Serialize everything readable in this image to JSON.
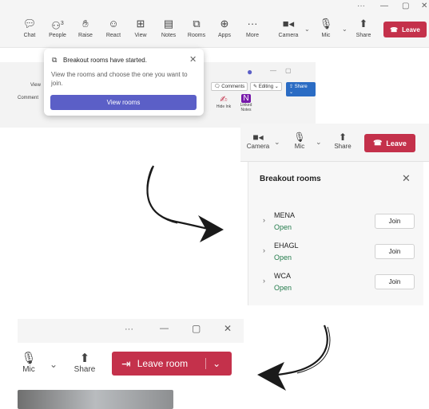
{
  "colors": {
    "leave": "#c4314b",
    "accent": "#5b5fc7",
    "open_status": "#237b4b"
  },
  "toolbar": {
    "items": [
      {
        "label": "Chat",
        "icon": "chat-icon"
      },
      {
        "label": "People",
        "icon": "people-icon",
        "badge": "3"
      },
      {
        "label": "Raise",
        "icon": "hand-icon"
      },
      {
        "label": "React",
        "icon": "smile-icon"
      },
      {
        "label": "View",
        "icon": "view-icon"
      },
      {
        "label": "Notes",
        "icon": "notes-icon"
      },
      {
        "label": "Rooms",
        "icon": "rooms-icon"
      },
      {
        "label": "Apps",
        "icon": "apps-icon"
      },
      {
        "label": "More",
        "icon": "more-icon"
      }
    ],
    "camera": "Camera",
    "mic": "Mic",
    "share": "Share",
    "leave": "Leave"
  },
  "doc_strip": {
    "comments": "Comments",
    "editing": "Editing",
    "share": "Share",
    "hide_ink": "Hide Ink",
    "linked_notes": "Linked Notes",
    "view_tab": "View",
    "comment_tab": "Comment"
  },
  "toast": {
    "title": "Breakout rooms have started.",
    "body": "View the rooms and choose the one you want to join.",
    "button": "View rooms"
  },
  "meeting_bar2": {
    "camera": "Camera",
    "mic": "Mic",
    "share": "Share",
    "leave": "Leave"
  },
  "breakout": {
    "title": "Breakout rooms",
    "rooms": [
      {
        "name": "MENA",
        "status": "Open",
        "join": "Join"
      },
      {
        "name": "EHAGL",
        "status": "Open",
        "join": "Join"
      },
      {
        "name": "WCA",
        "status": "Open",
        "join": "Join"
      }
    ]
  },
  "bottom": {
    "mic": "Mic",
    "share": "Share",
    "leave_room": "Leave room"
  }
}
